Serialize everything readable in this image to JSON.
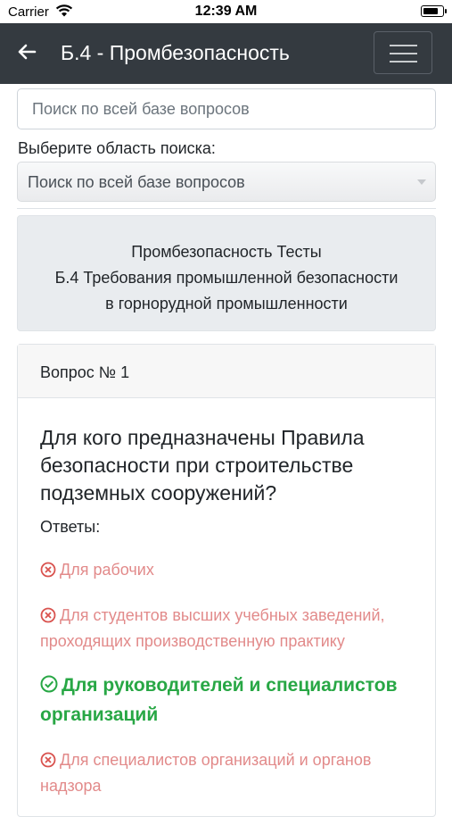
{
  "status_bar": {
    "carrier": "Carrier",
    "time": "12:39 AM"
  },
  "navbar": {
    "title": "Б.4 - Промбезопасность"
  },
  "search": {
    "placeholder": "Поиск по всей базе вопросов"
  },
  "area": {
    "label": "Выберите область поиска:",
    "selected": "Поиск по всей базе вопросов"
  },
  "info": {
    "line1": "Промбезопасность Тесты",
    "line2": "Б.4 Требования промышленной безопасности",
    "line3": "в горнорудной промышленности"
  },
  "question": {
    "header": "Вопрос № 1",
    "text": "Для кого предназначены Правила безопасности при строительстве подземных сооружений?",
    "answers_label": "Ответы:",
    "answers": [
      {
        "text": "Для рабочих",
        "correct": false
      },
      {
        "text": "Для студентов высших учебных заведений, проходящих производственную практику",
        "correct": false
      },
      {
        "text": "Для руководителей и специалистов организаций",
        "correct": true
      },
      {
        "text": "Для специалистов организаций и органов надзора",
        "correct": false
      }
    ]
  },
  "icons": {
    "wrong": "x-circle-icon",
    "correct": "check-circle-icon"
  },
  "colors": {
    "navbar": "#343a40",
    "wrong": "#e28a8a",
    "correct": "#28a745"
  }
}
